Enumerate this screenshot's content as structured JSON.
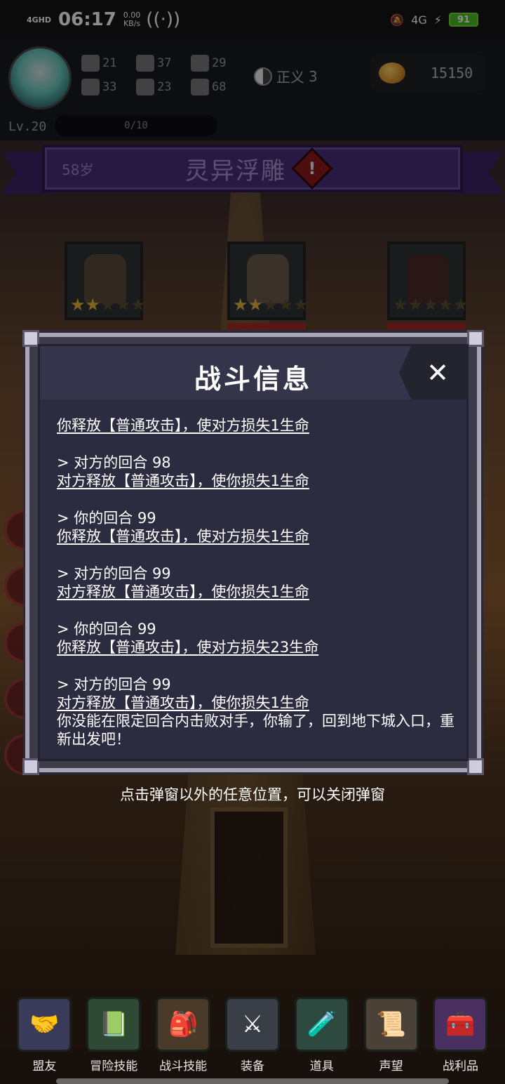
{
  "status_bar": {
    "network": "4GHD",
    "time": "06:17",
    "speed_value": "0.00",
    "speed_unit": "KB/s",
    "network_right": "4G",
    "battery": "91"
  },
  "header": {
    "stats": [
      {
        "icon": "fist-icon",
        "value": "21"
      },
      {
        "icon": "clover-icon",
        "value": "33"
      },
      {
        "icon": "boot-icon",
        "value": "37"
      },
      {
        "icon": "armor-icon",
        "value": "23"
      },
      {
        "icon": "wizard-hat-icon",
        "value": "29"
      },
      {
        "icon": "wings-icon",
        "value": "68"
      }
    ],
    "alignment_label": "正义",
    "alignment_value": "3",
    "gold": "15150",
    "level": "Lv.20",
    "exp": "0/10"
  },
  "banner": {
    "age": "58岁",
    "title": "灵异浮雕",
    "warning": "!"
  },
  "enemies": [
    {
      "stars_on": 2,
      "stars_total": 5
    },
    {
      "stars_on": 2,
      "stars_total": 5
    },
    {
      "stars_on": 0,
      "stars_total": 5
    }
  ],
  "dialog": {
    "title": "战斗信息",
    "close": "✕",
    "log": {
      "e0": {
        "action": "你释放【普通攻击】，使对方损失1生命"
      },
      "e1": {
        "turn": "> 对方的回合 98",
        "action": "对方释放【普通攻击】，使你损失1生命"
      },
      "e2": {
        "turn": "> 你的回合 99",
        "action": "你释放【普通攻击】，使对方损失1生命"
      },
      "e3": {
        "turn": "> 对方的回合 99",
        "action": "对方释放【普通攻击】，使你损失1生命"
      },
      "e4": {
        "turn": "> 你的回合 99",
        "action": "你释放【普通攻击】，使对方损失23生命"
      },
      "e5": {
        "turn": "> 对方的回合 99",
        "action": "对方释放【普通攻击】，使你损失1生命",
        "result": "你没能在限定回合内击败对手，你输了，回到地下城入口，重新出发吧！"
      }
    }
  },
  "hint": "点击弹窗以外的任意位置，可以关闭弹窗",
  "nav": [
    {
      "label": "盟友",
      "icon": "handshake-icon"
    },
    {
      "label": "冒险技能",
      "icon": "book-icon"
    },
    {
      "label": "战斗技能",
      "icon": "backpack-icon"
    },
    {
      "label": "装备",
      "icon": "swords-shield-icon"
    },
    {
      "label": "道具",
      "icon": "potion-bag-icon"
    },
    {
      "label": "声望",
      "icon": "scroll-icon"
    },
    {
      "label": "战利品",
      "icon": "treasure-chest-icon"
    }
  ]
}
